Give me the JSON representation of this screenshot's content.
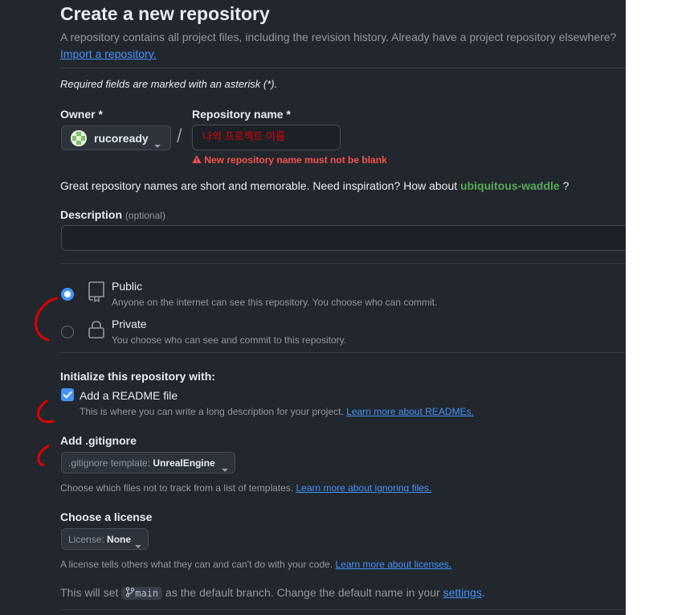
{
  "page": {
    "title": "Create a new repository",
    "intro": "A repository contains all project files, including the revision history. Already have a project repository elsewhere?",
    "import_link": "Import a repository.",
    "required_note": "Required fields are marked with an asterisk (*)."
  },
  "owner": {
    "label": "Owner *",
    "value": "rucoready"
  },
  "separator": "/",
  "repo": {
    "label": "Repository name *",
    "value": "나의 프로젝트 이름",
    "error": "New repository name must not be blank"
  },
  "inspiration": {
    "text": "Great repository names are short and memorable. Need inspiration? How about",
    "suggestion": "ubiquitous-waddle",
    "suffix": "?"
  },
  "description": {
    "label": "Description",
    "optional": "(optional)",
    "value": ""
  },
  "visibility": {
    "selected": "public",
    "public": {
      "title": "Public",
      "desc": "Anyone on the internet can see this repository. You choose who can commit."
    },
    "private": {
      "title": "Private",
      "desc": "You choose who can see and commit to this repository."
    }
  },
  "init": {
    "heading": "Initialize this repository with:",
    "readme": {
      "label": "Add a README file",
      "checked": true,
      "desc": "This is where you can write a long description for your project.",
      "link": "Learn more about READMEs."
    }
  },
  "gitignore": {
    "heading": "Add .gitignore",
    "prefix": ".gitignore template:",
    "value": "UnrealEngine",
    "desc": "Choose which files not to track from a list of templates.",
    "link": "Learn more about ignoring files."
  },
  "license": {
    "heading": "Choose a license",
    "prefix": "License:",
    "value": "None",
    "desc": "A license tells others what they can and can't do with your code.",
    "link": "Learn more about licenses."
  },
  "branch": {
    "prefix": "This will set",
    "name": "main",
    "middle": "as the default branch. Change the default name in your",
    "link": "settings",
    "suffix": "."
  },
  "colors": {
    "background": "#22272e",
    "accent": "#4493f8",
    "error": "#f85149",
    "suggestion": "#57ab5a",
    "annotation": "#e00000"
  }
}
